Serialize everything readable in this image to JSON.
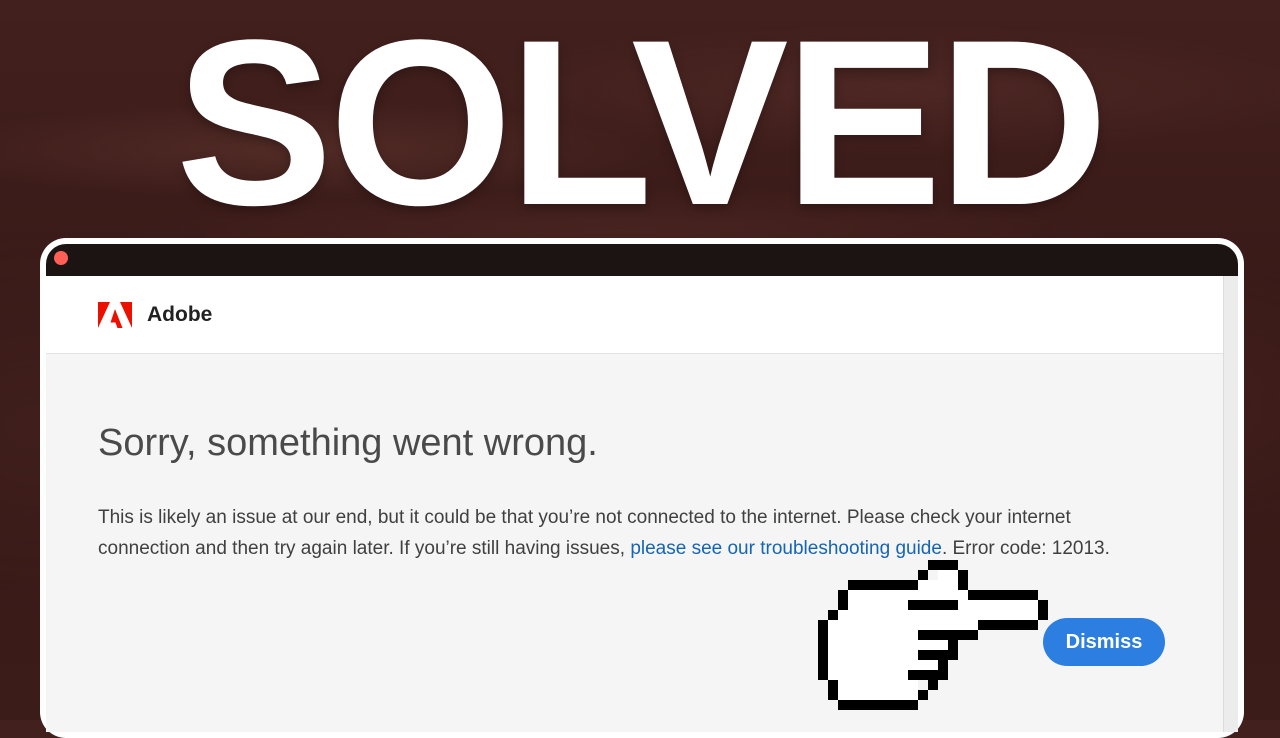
{
  "overlay": {
    "headline": "SOLVED"
  },
  "app": {
    "brand": "Adobe",
    "logo_icon": "adobe-logo-icon"
  },
  "error": {
    "title": "Sorry, something went wrong.",
    "message_part1": "This is likely an issue at our end, but it could be that you’re not connected to the internet. Please check your internet connection and then try again later. If you’re still having issues, ",
    "link_text": "please see our troubleshooting guide",
    "message_part2": ". Error code: 12013.",
    "error_code": "12013"
  },
  "actions": {
    "dismiss_label": "Dismiss"
  },
  "decor": {
    "pointer_icon": "pixel-pointing-hand-icon"
  },
  "colors": {
    "accent": "#2c7ee0",
    "link": "#1565b5",
    "adobe_red": "#eb1000",
    "background": "#3d1d1b"
  }
}
